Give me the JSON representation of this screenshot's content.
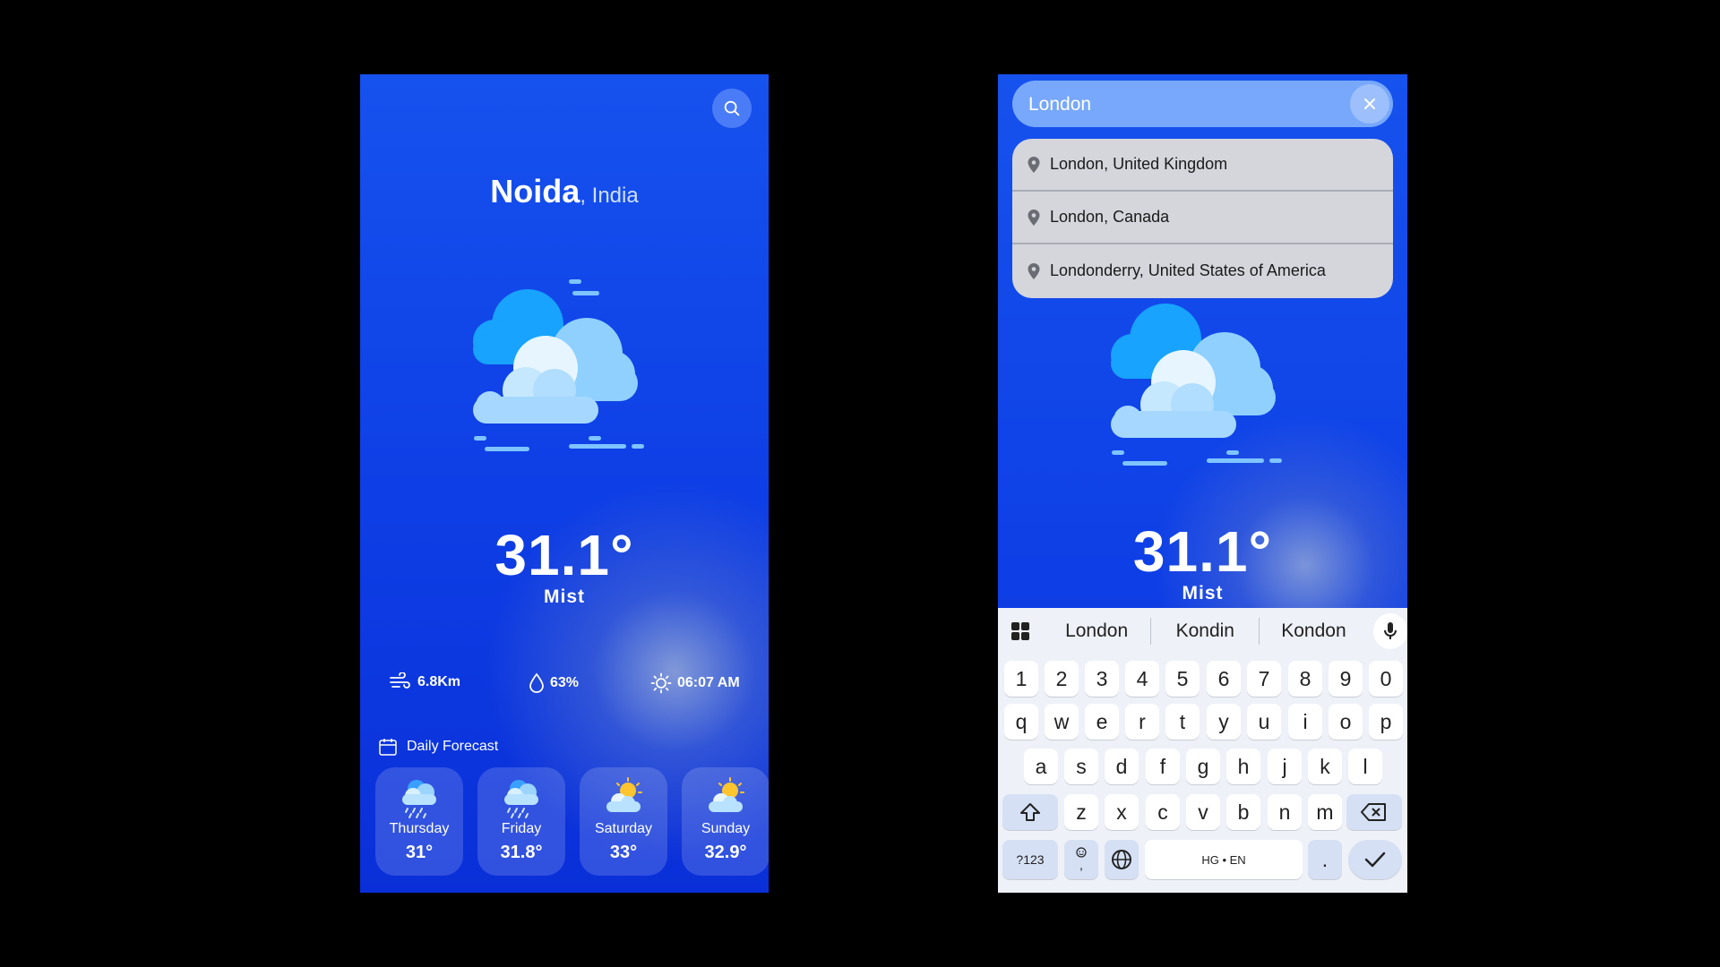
{
  "screen1": {
    "search_icon": "search-icon",
    "city": "Noida",
    "country": ", India",
    "temperature": "31.1°",
    "condition": "Mist",
    "stats": {
      "wind": "6.8Km",
      "humidity": "63%",
      "sunrise": "06:07 AM"
    },
    "daily_forecast_title": "Daily Forecast",
    "forecast": [
      {
        "day": "Thursday",
        "temp": "31°",
        "icon": "rain-cloud-icon"
      },
      {
        "day": "Friday",
        "temp": "31.8°",
        "icon": "rain-cloud-icon"
      },
      {
        "day": "Saturday",
        "temp": "33°",
        "icon": "partly-sunny-icon"
      },
      {
        "day": "Sunday",
        "temp": "32.9°",
        "icon": "partly-sunny-icon"
      }
    ]
  },
  "screen2": {
    "search_value": "London",
    "suggestions": [
      "London, United Kingdom",
      "London, Canada",
      "Londonderry, United States of America"
    ],
    "temperature": "31.1°",
    "condition": "Mist",
    "keyboard": {
      "suggestions": [
        "London",
        "Kondin",
        "Kondon"
      ],
      "row_numbers": [
        "1",
        "2",
        "3",
        "4",
        "5",
        "6",
        "7",
        "8",
        "9",
        "0"
      ],
      "row1": [
        "q",
        "w",
        "e",
        "r",
        "t",
        "y",
        "u",
        "i",
        "o",
        "p"
      ],
      "row2": [
        "a",
        "s",
        "d",
        "f",
        "g",
        "h",
        "j",
        "k",
        "l"
      ],
      "row3": [
        "z",
        "x",
        "c",
        "v",
        "b",
        "n",
        "m"
      ],
      "symbols_key": "?123",
      "comma_key": ",",
      "space_label": "HG • EN",
      "period_key": "."
    }
  },
  "colors": {
    "background": "#000000",
    "screen_blue": "#0e3fe6",
    "search_bar": "#78a8fb",
    "keyboard_bg": "#eef1f8"
  }
}
